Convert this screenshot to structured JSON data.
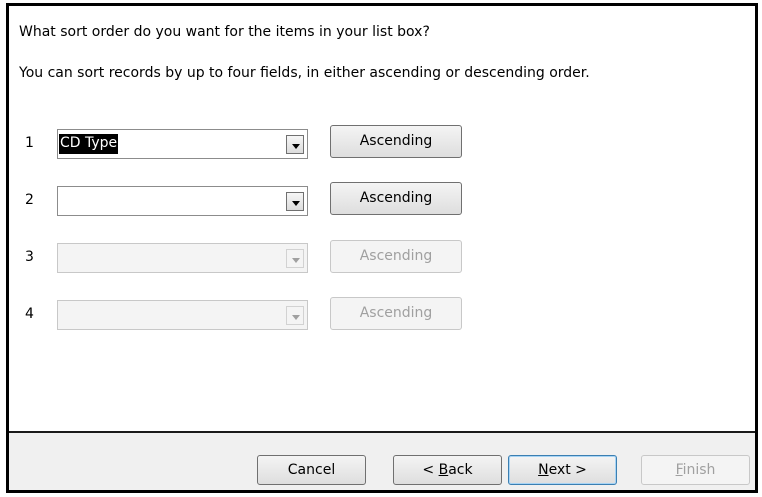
{
  "wizard": {
    "question": "What sort order do you want for the items in your list box?",
    "instructions": "You can sort records by up to four fields, in either ascending or descending order.",
    "sort_rows": [
      {
        "number": "1",
        "field": "CD Type",
        "order": "Ascending",
        "enabled": true
      },
      {
        "number": "2",
        "field": "",
        "order": "Ascending",
        "enabled": true
      },
      {
        "number": "3",
        "field": "",
        "order": "Ascending",
        "enabled": false
      },
      {
        "number": "4",
        "field": "",
        "order": "Ascending",
        "enabled": false
      }
    ],
    "buttons": {
      "cancel": "Cancel",
      "back_prefix": "< ",
      "back_key": "B",
      "back_rest": "ack",
      "next_key": "N",
      "next_rest": "ext >",
      "finish_key": "F",
      "finish_rest": "inish"
    }
  }
}
